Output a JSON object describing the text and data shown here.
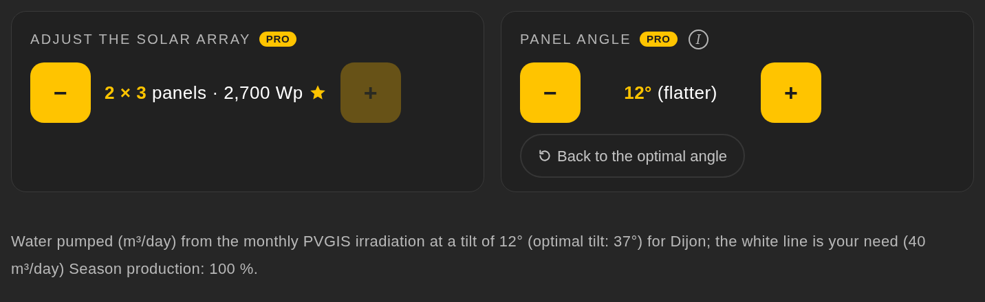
{
  "cards": [
    {
      "title": "ADJUST THE SOLAR ARRAY",
      "badge": "PRO",
      "info": false,
      "minus": {
        "label": "−",
        "disabled": false
      },
      "value": "2 × 3",
      "unit": "panels · 2,700 Wp",
      "starred": true,
      "plus": {
        "label": "+",
        "disabled": true
      }
    },
    {
      "title": "PANEL ANGLE",
      "badge": "PRO",
      "info": true,
      "info_label": "I",
      "minus": {
        "label": "−",
        "disabled": false
      },
      "value": "12°",
      "unit": "(flatter)",
      "starred": false,
      "plus": {
        "label": "+",
        "disabled": false
      },
      "reset": {
        "label": "Back to the optimal angle"
      }
    }
  ],
  "caption": "Water pumped (m³/day) from the monthly PVGIS irradiation at a tilt of 12° (optimal tilt: 37°) for Dijon; the white line is your need (40 m³/day) Season production: 100 %."
}
